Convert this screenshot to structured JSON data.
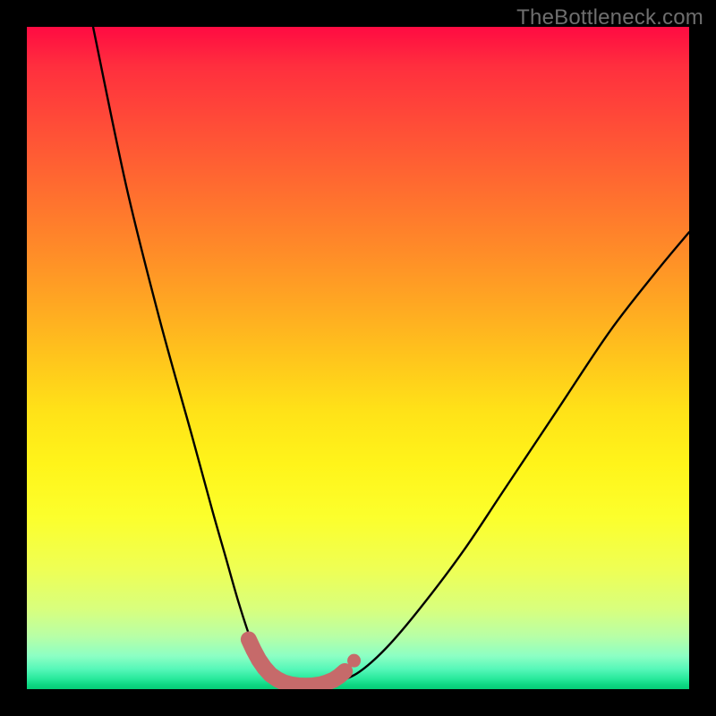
{
  "watermark": "TheBottleneck.com",
  "chart_data": {
    "type": "line",
    "title": "",
    "xlabel": "",
    "ylabel": "",
    "xlim": [
      0,
      100
    ],
    "ylim": [
      0,
      100
    ],
    "series": [
      {
        "name": "curve",
        "x": [
          10,
          15,
          20,
          25,
          28,
          30,
          32,
          34,
          36,
          38,
          41,
          44,
          48,
          51,
          55,
          60,
          66,
          72,
          80,
          88,
          95,
          100
        ],
        "values": [
          100,
          76,
          56,
          38,
          27,
          20,
          13,
          7,
          3,
          1.2,
          0.5,
          0.6,
          1.5,
          3.2,
          7,
          13,
          21,
          30,
          42,
          54,
          63,
          69
        ]
      }
    ],
    "markers": {
      "name": "highlight-band",
      "color": "#c66a6a",
      "points_xy": [
        [
          33.5,
          7.5
        ],
        [
          34.2,
          6.0
        ],
        [
          35.0,
          4.5
        ],
        [
          35.9,
          3.2
        ],
        [
          36.8,
          2.2
        ],
        [
          37.8,
          1.5
        ],
        [
          38.8,
          1.0
        ],
        [
          39.9,
          0.7
        ],
        [
          41.0,
          0.55
        ],
        [
          42.1,
          0.5
        ],
        [
          43.2,
          0.55
        ],
        [
          44.3,
          0.7
        ],
        [
          45.3,
          1.0
        ],
        [
          46.3,
          1.4
        ],
        [
          47.2,
          2.0
        ],
        [
          48.0,
          2.7
        ]
      ],
      "end_dot_xy": [
        49.4,
        4.3
      ]
    }
  }
}
